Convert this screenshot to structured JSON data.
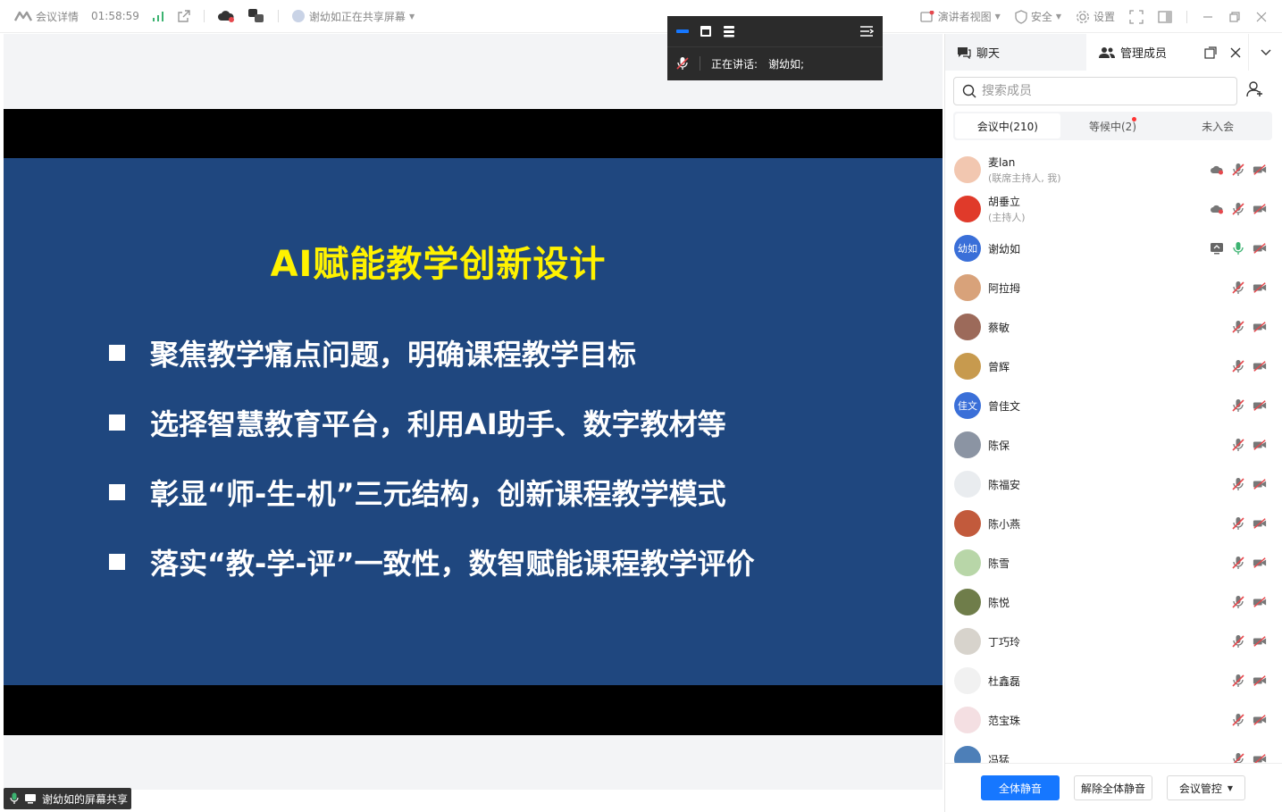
{
  "topbar": {
    "meeting_details": "会议详情",
    "duration": "01:58:59",
    "sharing_status": "谢幼如正在共享屏幕",
    "presenter_view": "演讲者视图",
    "security": "安全",
    "settings": "设置"
  },
  "slide": {
    "title": "AI赋能教学创新设计",
    "bullets": [
      "聚焦教学痛点问题，明确课程教学目标",
      "选择智慧教育平台，利用AI助手、数字教材等",
      "彰显“师-生-机”三元结构，创新课程教学模式",
      "落实“教-学-评”一致性，数智赋能课程教学评价"
    ]
  },
  "speaking": {
    "label": "正在讲话:",
    "name": "谢幼如;"
  },
  "share_badge": "谢幼如的屏幕共享",
  "panel": {
    "tab_chat": "聊天",
    "tab_members": "管理成员",
    "search_placeholder": "搜索成员",
    "segments": [
      "会议中(210)",
      "等候中(2)",
      "未入会"
    ],
    "members": [
      {
        "name": "麦lan",
        "role": "(联席主持人, 我)",
        "avatar_color": "#f2c7b0",
        "cloud": true,
        "mic": "muted"
      },
      {
        "name": "胡垂立",
        "role": "(主持人)",
        "avatar_color": "#e03a2a",
        "cloud": true,
        "mic": "muted"
      },
      {
        "name": "谢幼如",
        "role": "",
        "avatar_text": "幼如",
        "avatar_color": "#3a6fd8",
        "screen": true,
        "mic": "on"
      },
      {
        "name": "阿拉拇",
        "role": "",
        "avatar_color": "#d8a27a",
        "mic": "muted"
      },
      {
        "name": "蔡敏",
        "role": "",
        "avatar_color": "#9c6a5a",
        "mic": "muted"
      },
      {
        "name": "曾辉",
        "role": "",
        "avatar_color": "#c79a4e",
        "mic": "muted"
      },
      {
        "name": "曾佳文",
        "role": "",
        "avatar_text": "佳文",
        "avatar_color": "#3a6fd8",
        "mic": "muted"
      },
      {
        "name": "陈保",
        "role": "",
        "avatar_color": "#8b94a3",
        "mic": "muted"
      },
      {
        "name": "陈福安",
        "role": "",
        "avatar_color": "#e9ecef",
        "mic": "muted"
      },
      {
        "name": "陈小燕",
        "role": "",
        "avatar_color": "#c25a3c",
        "mic": "muted"
      },
      {
        "name": "陈雪",
        "role": "",
        "avatar_color": "#b8d6a8",
        "mic": "muted"
      },
      {
        "name": "陈悦",
        "role": "",
        "avatar_color": "#6f7d4a",
        "mic": "muted"
      },
      {
        "name": "丁巧玲",
        "role": "",
        "avatar_color": "#d7d3cc",
        "mic": "muted"
      },
      {
        "name": "杜鑫磊",
        "role": "",
        "avatar_color": "#f1f1f1",
        "mic": "muted"
      },
      {
        "name": "范宝珠",
        "role": "",
        "avatar_color": "#f4dfe2",
        "mic": "muted"
      },
      {
        "name": "冯猛",
        "role": "",
        "avatar_color": "#4d7fb8",
        "mic": "muted"
      }
    ],
    "buttons": {
      "mute_all": "全体静音",
      "unmute_all": "解除全体静音",
      "meeting_control": "会议管控"
    }
  },
  "colors": {
    "accent": "#1677ff",
    "slide_bg": "#1f477f",
    "title_yellow": "#fff200",
    "mute_red": "#e5484d"
  }
}
